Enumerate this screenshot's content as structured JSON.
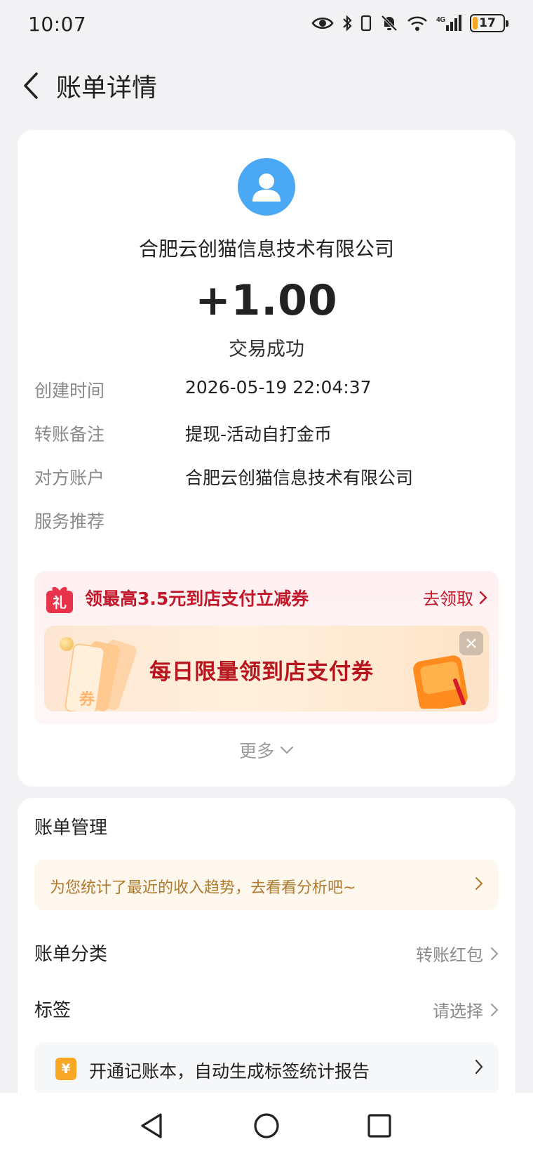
{
  "status_bar": {
    "time": "10:07",
    "battery_level": "17",
    "battery_fraction": 0.17,
    "network_label": "4G",
    "icons": [
      "eye-icon",
      "bluetooth-icon",
      "vibrate-icon",
      "mute-bell-icon",
      "wifi-icon",
      "signal-icon",
      "battery-icon"
    ]
  },
  "header": {
    "title": "账单详情",
    "back_icon": "back-arrow-icon"
  },
  "transaction": {
    "avatar_icon": "user-avatar-icon",
    "counterparty": "合肥云创猫信息技术有限公司",
    "amount": "+1.00",
    "status": "交易成功"
  },
  "details": [
    {
      "label": "创建时间",
      "value": "2026-05-19 22:04:37"
    },
    {
      "label": "转账备注",
      "value": "提现-活动自打金币"
    },
    {
      "label": "对方账户",
      "value": "合肥云创猫信息技术有限公司"
    },
    {
      "label": "服务推荐",
      "value": ""
    }
  ],
  "promo": {
    "gift_icon_text": "礼",
    "title": "领最高3.5元到店支付立减券",
    "link": "去领取",
    "banner_text": "每日限量领到店支付券",
    "ticket_text": "券"
  },
  "more": {
    "label": "更多"
  },
  "manage": {
    "title": "账单管理",
    "analysis_tip": "为您统计了最近的收入趋势，去看看分析吧~",
    "category_label": "账单分类",
    "category_value": "转账红包",
    "tag_label": "标签",
    "tag_value": "请选择",
    "ledger_icon_text": "¥",
    "ledger_tip": "开通记账本，自动生成标签统计报告"
  },
  "colors": {
    "accent_blue": "#4aa8f5",
    "promo_red": "#c0182a",
    "tip_gold": "#b07a2c",
    "ledger_orange": "#f9a825",
    "background": "#f2f2f4"
  },
  "nav": {
    "icons": [
      "nav-back-icon",
      "nav-home-icon",
      "nav-recents-icon"
    ]
  }
}
